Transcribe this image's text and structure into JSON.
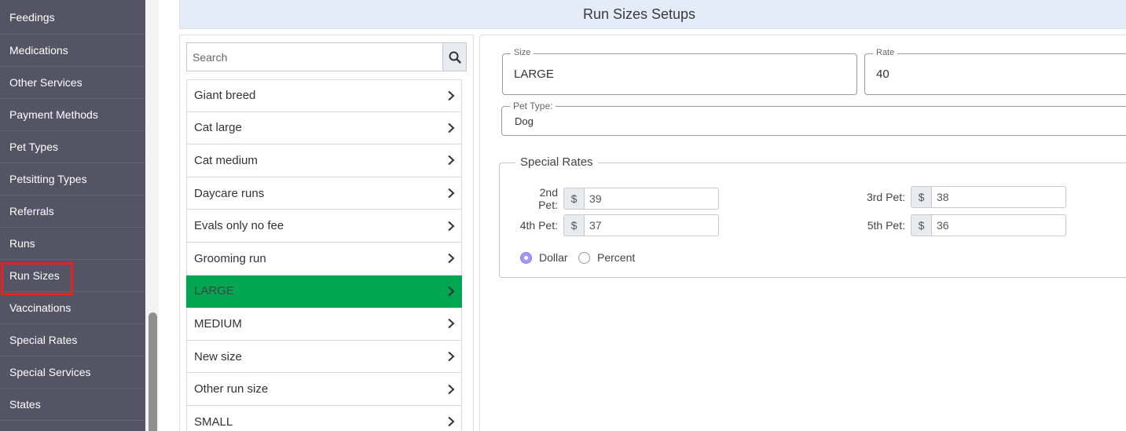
{
  "sidebar": {
    "items": [
      {
        "label": "Feedings"
      },
      {
        "label": "Medications"
      },
      {
        "label": "Other Services"
      },
      {
        "label": "Payment Methods"
      },
      {
        "label": "Pet Types"
      },
      {
        "label": "Petsitting Types"
      },
      {
        "label": "Referrals"
      },
      {
        "label": "Runs"
      },
      {
        "label": "Run Sizes"
      },
      {
        "label": "Vaccinations"
      },
      {
        "label": "Special Rates"
      },
      {
        "label": "Special Services"
      },
      {
        "label": "States"
      }
    ],
    "active_item": "Run Sizes"
  },
  "header": {
    "title": "Run Sizes Setups"
  },
  "search": {
    "placeholder": "Search",
    "value": "",
    "icon": "search-icon"
  },
  "run_sizes": [
    {
      "label": "Giant breed"
    },
    {
      "label": "Cat large"
    },
    {
      "label": "Cat medium"
    },
    {
      "label": "Daycare runs"
    },
    {
      "label": "Evals only no fee"
    },
    {
      "label": "Grooming run"
    },
    {
      "label": "LARGE"
    },
    {
      "label": "MEDIUM"
    },
    {
      "label": "New size"
    },
    {
      "label": "Other run size"
    },
    {
      "label": "SMALL"
    }
  ],
  "selected_run_size": "LARGE",
  "form": {
    "size_label": "Size",
    "size_value": "LARGE",
    "rate_label": "Rate",
    "rate_value": "40",
    "pet_type_label": "Pet Type:",
    "pet_type_value": "Dog"
  },
  "special_rates": {
    "legend": "Special Rates",
    "currency_symbol": "$",
    "pet2_label": "2nd Pet:",
    "pet2_value": "39",
    "pet3_label": "3rd Pet:",
    "pet3_value": "38",
    "pet4_label": "4th Pet:",
    "pet4_value": "37",
    "pet5_label": "5th Pet:",
    "pet5_value": "36",
    "dollar_label": "Dollar",
    "percent_label": "Percent",
    "selected_mode": "Dollar"
  },
  "colors": {
    "sidebar_bg": "#555465",
    "selected_row": "#00a651",
    "highlight_box": "#e32222",
    "header_bg": "#e3ecf7",
    "radio_accent": "#a897f0"
  }
}
